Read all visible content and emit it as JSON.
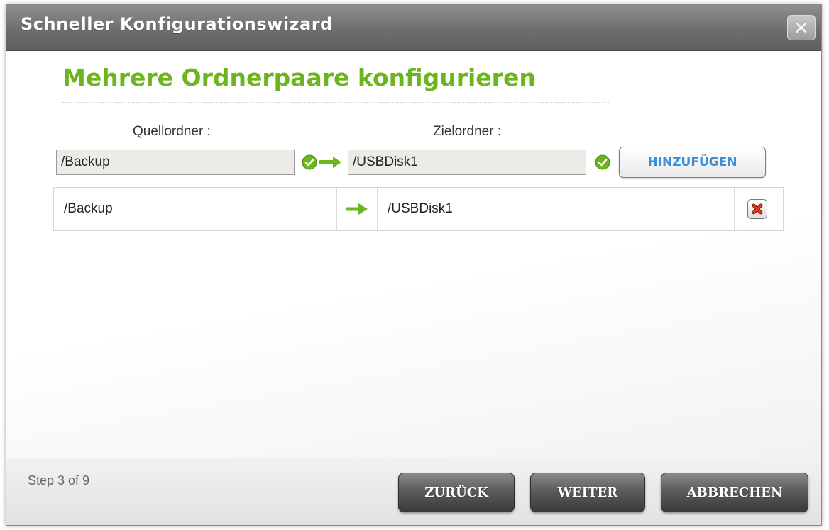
{
  "dialog": {
    "title": "Schneller Konfigurationswizard",
    "close_label": "X"
  },
  "main": {
    "heading": "Mehrere Ordnerpaare konfigurieren",
    "source_label": "Quellordner :",
    "target_label": "Zielordner :",
    "source_value": "/Backup",
    "target_value": "/USBDisk1",
    "add_button": "HINZUFÜGEN",
    "pairs": [
      {
        "source": "/Backup",
        "target": "/USBDisk1"
      }
    ]
  },
  "footer": {
    "step_text": "Step 3 of 9",
    "back_button": "ZURÜCK",
    "next_button": "WEITER",
    "cancel_button": "ABBRECHEN"
  },
  "colors": {
    "accent_green": "#6db51e",
    "add_button_text": "#3a8fd8",
    "delete_red": "#e0341c"
  },
  "icons": {
    "close": "close-icon",
    "valid": "check-circle-icon",
    "arrow": "arrow-right-icon",
    "delete": "delete-icon"
  }
}
